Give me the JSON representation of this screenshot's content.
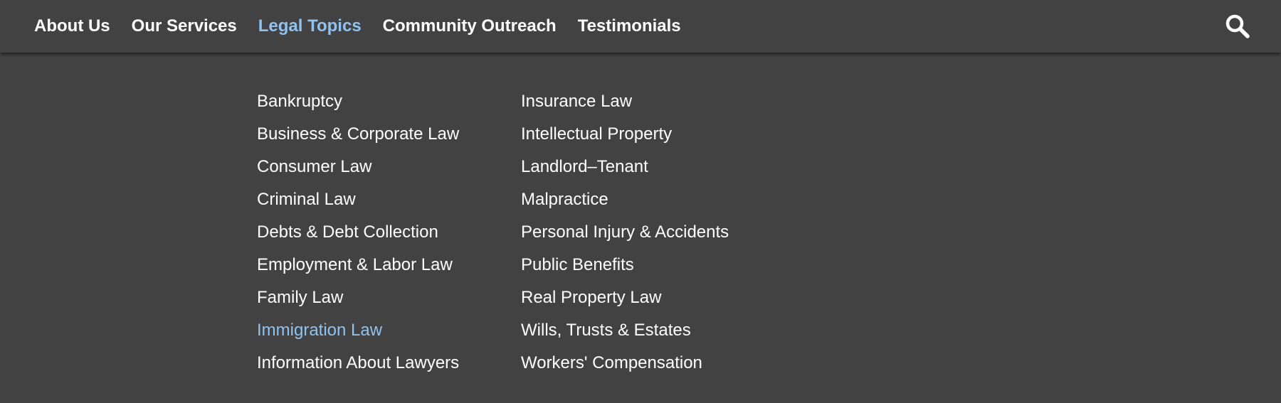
{
  "nav": {
    "items": [
      {
        "label": "About Us",
        "active": false
      },
      {
        "label": "Our Services",
        "active": false
      },
      {
        "label": "Legal Topics",
        "active": true
      },
      {
        "label": "Community Outreach",
        "active": false
      },
      {
        "label": "Testimonials",
        "active": false
      }
    ],
    "search_icon": "search-icon"
  },
  "dropdown": {
    "column1": [
      {
        "label": "Bankruptcy",
        "active": false
      },
      {
        "label": "Business & Corporate Law",
        "active": false
      },
      {
        "label": "Consumer Law",
        "active": false
      },
      {
        "label": "Criminal Law",
        "active": false
      },
      {
        "label": "Debts & Debt Collection",
        "active": false
      },
      {
        "label": "Employment & Labor Law",
        "active": false
      },
      {
        "label": "Family Law",
        "active": false
      },
      {
        "label": "Immigration Law",
        "active": true
      },
      {
        "label": "Information About Lawyers",
        "active": false
      }
    ],
    "column2": [
      {
        "label": "Insurance Law",
        "active": false
      },
      {
        "label": "Intellectual Property",
        "active": false
      },
      {
        "label": "Landlord–Tenant",
        "active": false
      },
      {
        "label": "Malpractice",
        "active": false
      },
      {
        "label": "Personal Injury & Accidents",
        "active": false
      },
      {
        "label": "Public Benefits",
        "active": false
      },
      {
        "label": "Real Property Law",
        "active": false
      },
      {
        "label": "Wills, Trusts & Estates",
        "active": false
      },
      {
        "label": "Workers' Compensation",
        "active": false
      }
    ]
  },
  "colors": {
    "background": "#424242",
    "text": "#ffffff",
    "accent": "#8fc3ef"
  }
}
